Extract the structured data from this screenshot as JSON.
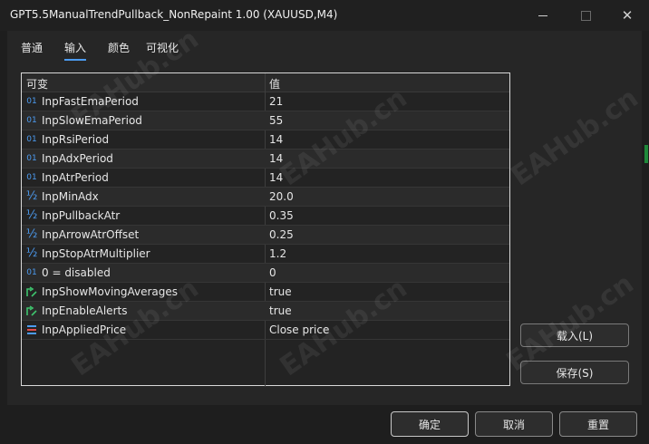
{
  "window": {
    "title": "GPT5.5ManualTrendPullback_NonRepaint 1.00 (XAUUSD,M4)"
  },
  "tabs": [
    {
      "label": "普通",
      "active": false
    },
    {
      "label": "输入",
      "active": true
    },
    {
      "label": "颜色",
      "active": false
    },
    {
      "label": "可视化",
      "active": false
    }
  ],
  "grid": {
    "col_variable": "可变",
    "col_value": "值",
    "rows": [
      {
        "icon": "01",
        "type": "int",
        "name": "InpFastEmaPeriod",
        "value": "21"
      },
      {
        "icon": "01",
        "type": "int",
        "name": "InpSlowEmaPeriod",
        "value": "55"
      },
      {
        "icon": "01",
        "type": "int",
        "name": "InpRsiPeriod",
        "value": "14"
      },
      {
        "icon": "01",
        "type": "int",
        "name": "InpAdxPeriod",
        "value": "14"
      },
      {
        "icon": "01",
        "type": "int",
        "name": "InpAtrPeriod",
        "value": "14"
      },
      {
        "icon": "½",
        "type": "double",
        "name": "InpMinAdx",
        "value": "20.0"
      },
      {
        "icon": "½",
        "type": "double",
        "name": "InpPullbackAtr",
        "value": "0.35"
      },
      {
        "icon": "½",
        "type": "double",
        "name": "InpArrowAtrOffset",
        "value": "0.25"
      },
      {
        "icon": "½",
        "type": "double",
        "name": "InpStopAtrMultiplier",
        "value": "1.2"
      },
      {
        "icon": "01",
        "type": "int",
        "name": "0 = disabled",
        "value": "0"
      },
      {
        "icon": "bool",
        "type": "bool",
        "name": "InpShowMovingAverages",
        "value": "true"
      },
      {
        "icon": "bool",
        "type": "bool",
        "name": "InpEnableAlerts",
        "value": "true"
      },
      {
        "icon": "enum",
        "type": "enum",
        "name": "InpAppliedPrice",
        "value": "Close price"
      }
    ]
  },
  "side_buttons": {
    "load": "载入(L)",
    "save": "保存(S)"
  },
  "footer": {
    "ok": "确定",
    "cancel": "取消",
    "reset": "重置"
  },
  "watermark": "EAHub.cn",
  "colors": {
    "accent": "#4c9bf0",
    "bool_icon": "#3ec46d",
    "enum_icon": "#e24a4a"
  }
}
